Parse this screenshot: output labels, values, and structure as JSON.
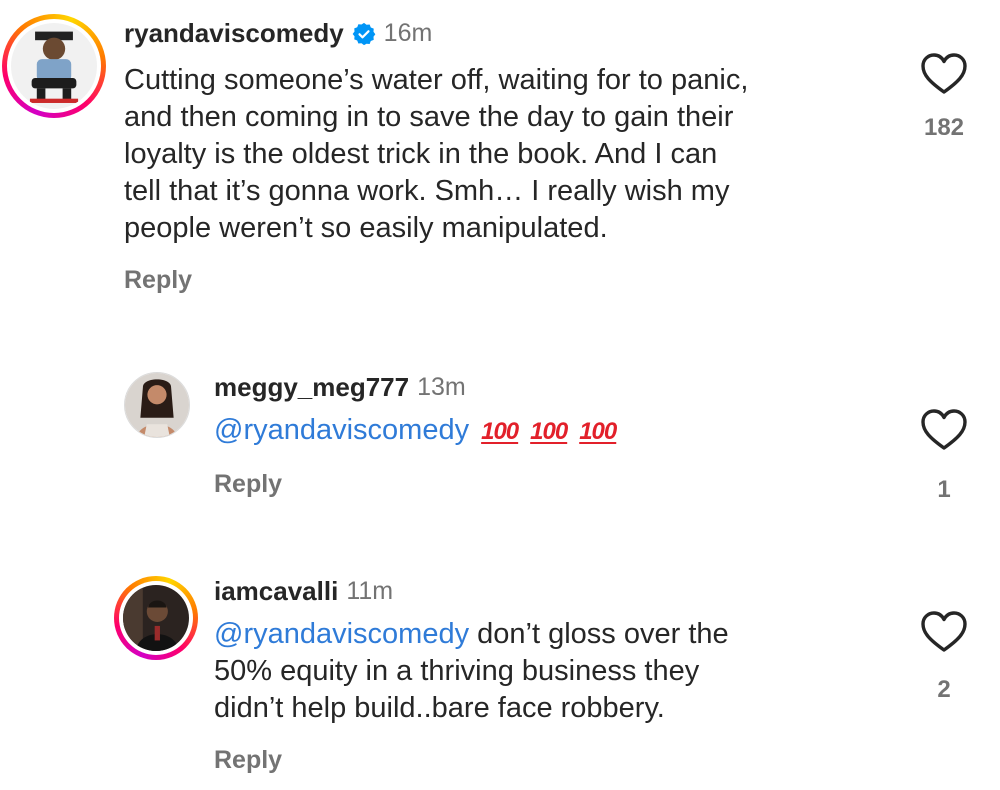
{
  "comments": [
    {
      "username": "ryandaviscomedy",
      "verified": true,
      "time": "16m",
      "lines": [
        "Cutting someone’s water off, waiting for to panic,",
        "and then coming in to save the day to gain their",
        "loyalty is the oldest trick in the book. And I can",
        "tell that it’s gonna work. Smh… I really wish my",
        "people weren’t so easily manipulated."
      ],
      "reply_label": "Reply",
      "likes": "182",
      "avatar_icon": "person-avatar-icon"
    },
    {
      "username": "meggy_meg777",
      "time": "13m",
      "mention": "@ryandaviscomedy",
      "emoji": [
        "100",
        "100",
        "100"
      ],
      "reply_label": "Reply",
      "likes": "1",
      "avatar_icon": "person-avatar-icon"
    },
    {
      "username": "iamcavalli",
      "time": "11m",
      "mention": "@ryandaviscomedy",
      "lines": [
        " don’t gloss over the",
        "50% equity in a thriving business they",
        "didn’t help build..bare face robbery."
      ],
      "reply_label": "Reply",
      "likes": "2",
      "avatar_icon": "person-avatar-icon"
    }
  ],
  "colors": {
    "mention": "#2f7bd8",
    "verified": "#0095f6",
    "secondary_text": "#737373",
    "hundred_emoji": "#e2202a"
  }
}
